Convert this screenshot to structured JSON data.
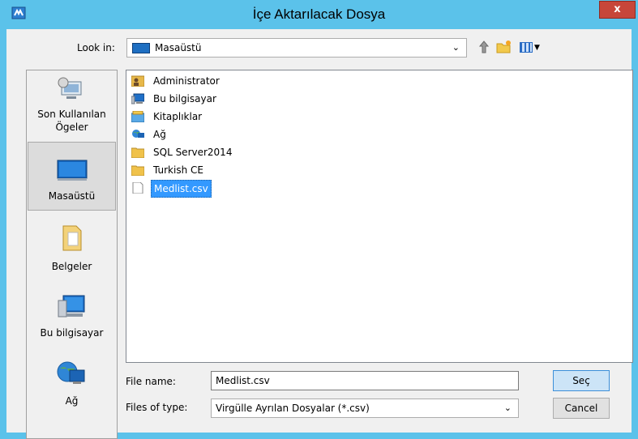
{
  "window": {
    "title": "İçe Aktarılacak Dosya",
    "close_label": "x"
  },
  "toolbar": {
    "look_in_label": "Look in:",
    "look_in_value": "Masaüstü",
    "up_icon": "up-folder-icon",
    "new_folder_icon": "new-folder-icon",
    "view_menu_icon": "view-menu-icon"
  },
  "places": [
    {
      "label": "Son Kullanılan Ögeler",
      "icon": "recent-items-icon"
    },
    {
      "label": "Masaüstü",
      "icon": "desktop-icon",
      "selected": true
    },
    {
      "label": "Belgeler",
      "icon": "documents-icon"
    },
    {
      "label": "Bu bilgisayar",
      "icon": "computer-icon"
    },
    {
      "label": "Ağ",
      "icon": "network-icon"
    }
  ],
  "files": [
    {
      "name": "Administrator",
      "icon": "user-folder-icon"
    },
    {
      "name": "Bu bilgisayar",
      "icon": "computer-icon"
    },
    {
      "name": "Kitaplıklar",
      "icon": "libraries-icon"
    },
    {
      "name": "Ağ",
      "icon": "network-icon"
    },
    {
      "name": "SQL Server2014",
      "icon": "folder-icon"
    },
    {
      "name": "Turkish CE",
      "icon": "folder-icon"
    },
    {
      "name": "Medlist.csv",
      "icon": "file-icon",
      "selected": true
    }
  ],
  "form": {
    "file_name_label": "File name:",
    "file_name_value": "Medlist.csv",
    "file_type_label": "Files of type:",
    "file_type_value": "Virgülle Ayrılan Dosyalar (*.csv)"
  },
  "buttons": {
    "open_label": "Seç",
    "cancel_label": "Cancel"
  },
  "colors": {
    "titlebar": "#5bc2ea",
    "close_button": "#c7463a",
    "selection": "#3399ff",
    "default_button": "#cce4f7"
  }
}
